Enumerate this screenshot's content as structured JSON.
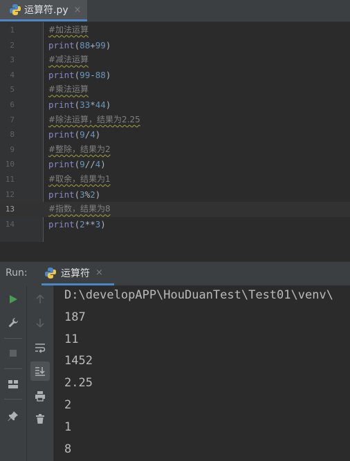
{
  "editor_tab": {
    "filename": "运算符.py",
    "close": "×"
  },
  "editor": {
    "current_line": 13,
    "lines": [
      {
        "n": "1",
        "type": "comment",
        "text": "#加法运算"
      },
      {
        "n": "2",
        "type": "code",
        "text": "print(88+99)"
      },
      {
        "n": "3",
        "type": "comment",
        "text": "#减法运算"
      },
      {
        "n": "4",
        "type": "code",
        "text": "print(99-88)"
      },
      {
        "n": "5",
        "type": "comment",
        "text": "#乘法运算"
      },
      {
        "n": "6",
        "type": "code",
        "text": "print(33*44)"
      },
      {
        "n": "7",
        "type": "comment",
        "text": "#除法运算，结果为2.25"
      },
      {
        "n": "8",
        "type": "code",
        "text": "print(9/4)"
      },
      {
        "n": "9",
        "type": "comment",
        "text": "#整除，结果为2"
      },
      {
        "n": "10",
        "type": "code",
        "text": "print(9//4)"
      },
      {
        "n": "11",
        "type": "comment",
        "text": "#取余，结果为1"
      },
      {
        "n": "12",
        "type": "code",
        "text": "print(3%2)"
      },
      {
        "n": "13",
        "type": "comment",
        "text": "#指数，结果为8"
      },
      {
        "n": "14",
        "type": "code",
        "text": "print(2**3)"
      }
    ]
  },
  "run_window": {
    "title": "Run:",
    "tab_label": "运算符",
    "close": "×",
    "output": [
      "D:\\developAPP\\HouDuanTest\\Test01\\venv\\",
      "187",
      "11",
      "1452",
      "2.25",
      "2",
      "1",
      "8"
    ]
  },
  "icons": {
    "col1": [
      "run-icon",
      "wrench-icon",
      "stop-icon",
      "layout-icon",
      "pin-icon"
    ],
    "col2": [
      "arrow-up-icon",
      "arrow-down-icon",
      "soft-wrap-icon",
      "scroll-to-end-icon",
      "print-icon",
      "trash-icon"
    ]
  },
  "colors": {
    "accent": "#4a88c7",
    "run_green": "#499c54",
    "comment": "#808080",
    "number": "#6897bb",
    "builtin": "#8888c6"
  }
}
